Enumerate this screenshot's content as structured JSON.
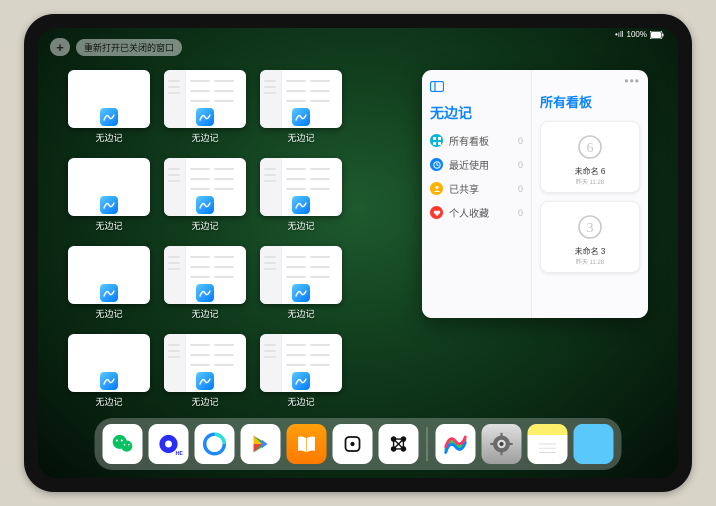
{
  "top": {
    "plus": "+",
    "reopen_label": "重新打开已关闭的窗口"
  },
  "status": {
    "signal": "•ıll",
    "battery_pct": "100%"
  },
  "thumbs": {
    "label": "无边记",
    "rows": [
      [
        "blank",
        "grid",
        "grid"
      ],
      [
        "blank",
        "grid",
        "grid"
      ],
      [
        "blank",
        "grid",
        "grid"
      ],
      [
        "blank",
        "grid",
        "grid"
      ]
    ]
  },
  "panel": {
    "app_title": "无边记",
    "right_title": "所有看板",
    "items": [
      {
        "label": "所有看板",
        "count": "0",
        "color": "#06b6d4",
        "icon": "grid"
      },
      {
        "label": "最近使用",
        "count": "0",
        "color": "#0a84ff",
        "icon": "clock"
      },
      {
        "label": "已共享",
        "count": "0",
        "color": "#ffb300",
        "icon": "people"
      },
      {
        "label": "个人收藏",
        "count": "0",
        "color": "#ff3b30",
        "icon": "heart"
      }
    ],
    "boards": [
      {
        "name": "未命名 6",
        "time": "昨天 11:28",
        "digit": "6"
      },
      {
        "name": "未命名 3",
        "time": "昨天 11:28",
        "digit": "3"
      }
    ]
  },
  "dock": {
    "left": [
      {
        "name": "wechat-icon"
      },
      {
        "name": "quark-icon"
      },
      {
        "name": "qq-browser-icon"
      },
      {
        "name": "play-store-icon"
      },
      {
        "name": "books-icon"
      },
      {
        "name": "dice-app-icon"
      },
      {
        "name": "connect-app-icon"
      }
    ],
    "right": [
      {
        "name": "freeform-icon"
      },
      {
        "name": "settings-icon"
      },
      {
        "name": "notes-icon"
      },
      {
        "name": "app-folder-icon"
      }
    ]
  }
}
